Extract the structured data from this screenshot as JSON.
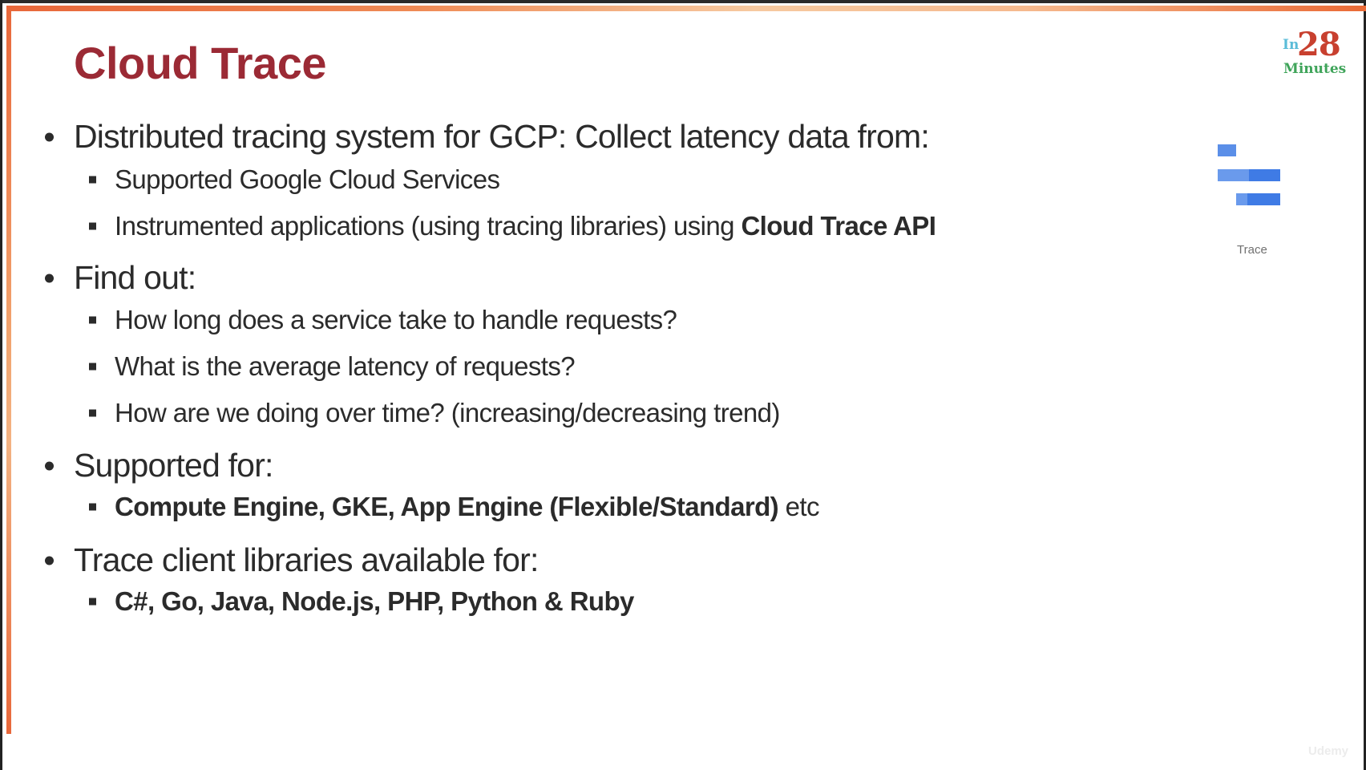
{
  "slide": {
    "title": "Cloud Trace",
    "logo": {
      "prefix": "In",
      "number": "28",
      "suffix": "Minutes"
    },
    "product_icon": {
      "name": "trace-icon",
      "label": "Trace"
    },
    "watermark": "Udemy",
    "colors": {
      "title": "#9b2a35",
      "frame_accent": "#e8673a",
      "trace_icon_blue": "#4a84e6",
      "logo_in": "#5bbcd8",
      "logo_number": "#c8402f",
      "logo_minutes": "#3fa45a"
    }
  },
  "bullets": [
    {
      "text": "Distributed tracing system for GCP: Collect latency data from:",
      "sub": [
        {
          "parts": [
            {
              "text": "Supported Google Cloud Services",
              "bold": false
            }
          ]
        },
        {
          "parts": [
            {
              "text": "Instrumented applications (using tracing libraries) using ",
              "bold": false
            },
            {
              "text": "Cloud Trace API",
              "bold": true
            }
          ]
        }
      ]
    },
    {
      "text": "Find out:",
      "sub": [
        {
          "parts": [
            {
              "text": "How long does a service take to handle requests?",
              "bold": false
            }
          ]
        },
        {
          "parts": [
            {
              "text": "What is the average latency of requests?",
              "bold": false
            }
          ]
        },
        {
          "parts": [
            {
              "text": "How are we doing over time? (increasing/decreasing trend)",
              "bold": false
            }
          ]
        }
      ]
    },
    {
      "text": "Supported for:",
      "sub": [
        {
          "parts": [
            {
              "text": "Compute Engine, GKE, App Engine (Flexible/Standard)",
              "bold": true
            },
            {
              "text": " etc",
              "bold": false
            }
          ]
        }
      ]
    },
    {
      "text": "Trace client libraries available for:",
      "sub": [
        {
          "parts": [
            {
              "text": "C#, Go, Java, Node.js, PHP, Python & Ruby",
              "bold": true
            }
          ]
        }
      ]
    }
  ]
}
